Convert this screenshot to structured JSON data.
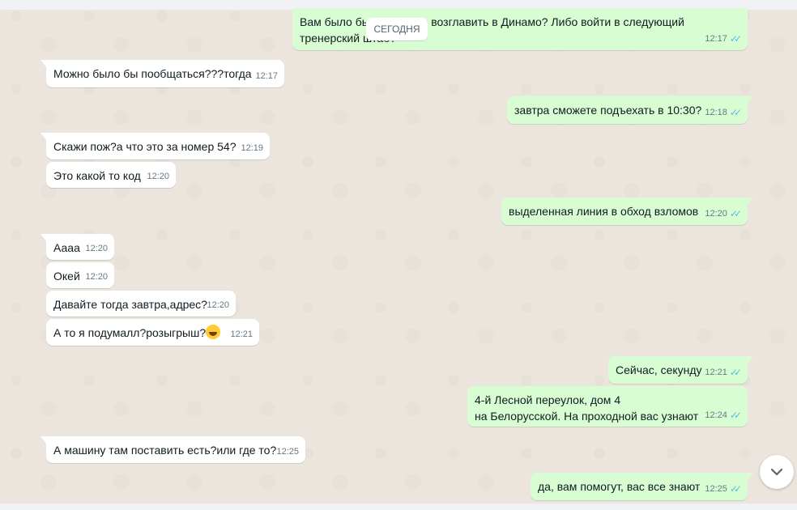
{
  "date_label": "СЕГОДНЯ",
  "messages": [
    {
      "text": "Вам было бы интересно возглавить в Динамо? Либо войти в следующий тренерский штаб?",
      "time": "12:17"
    },
    {
      "text": "Можно было бы пообщаться???тогда",
      "time": "12:17"
    },
    {
      "text": "завтра сможете подъехать в 10:30?",
      "time": "12:18"
    },
    {
      "text": "Скажи пож?а что это за номер 54?",
      "time": "12:19"
    },
    {
      "text": "Это какой то код",
      "time": "12:20"
    },
    {
      "text": "выделенная линия в обход взломов",
      "time": "12:20"
    },
    {
      "text": "Аааа",
      "time": "12:20"
    },
    {
      "text": "Окей",
      "time": "12:20"
    },
    {
      "text": "Давайте тогда завтра,адрес?",
      "time": "12:20"
    },
    {
      "text": "А то я подумалл?розыгрыш?",
      "time": "12:21"
    },
    {
      "text": "Сейчас, секунду",
      "time": "12:21"
    },
    {
      "text": "4-й Лесной переулок, дом 4\nна Белорусской. На проходной вас узнают",
      "time": "12:24"
    },
    {
      "text": "А машину там поставить есть?или где то?",
      "time": "12:25"
    },
    {
      "text": "да, вам помогут, вас все знают",
      "time": "12:25"
    }
  ],
  "icons": {
    "read_receipt": "double-check-icon",
    "emoji": "laughing-emoji-icon",
    "scroll_down": "chevron-down-icon"
  },
  "colors": {
    "incoming_bg": "#ffffff",
    "outgoing_bg": "#d9fdd3",
    "read_tick": "#53bdeb",
    "chat_bg": "#ece5dd"
  }
}
